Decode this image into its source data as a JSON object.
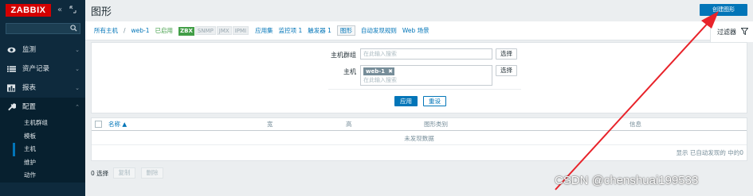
{
  "sidebar": {
    "logo": "ZABBIX",
    "collapse_glyph": "«",
    "expand_glyph": "⬚",
    "search_placeholder": "",
    "menu": [
      {
        "label": "监测",
        "icon": "eye-icon"
      },
      {
        "label": "资产记录",
        "icon": "list-icon"
      },
      {
        "label": "报表",
        "icon": "bar-chart-icon"
      },
      {
        "label": "配置",
        "icon": "wrench-icon"
      }
    ],
    "submenu": [
      "主机群组",
      "模板",
      "主机",
      "维护",
      "动作"
    ]
  },
  "header": {
    "title": "图形",
    "create_button": "创建图形"
  },
  "nav": {
    "all_hosts": "所有主机",
    "separator": "/",
    "host": "web-1",
    "status": "已启用",
    "tags": [
      "ZBX",
      "SNMP",
      "JMX",
      "IPMI"
    ],
    "links": [
      "应用集",
      "监控项 1",
      "触发器 1",
      "图形",
      "自动发现规则",
      "Web 场景"
    ]
  },
  "filter": {
    "tab_label": "过滤器",
    "host_group_label": "主机群组",
    "host_group_placeholder": "在此输入搜索",
    "host_label": "主机",
    "host_chip": "web-1",
    "host_placeholder": "在此输入搜索",
    "select_label": "选择",
    "apply_label": "应用",
    "reset_label": "重设"
  },
  "table": {
    "columns": [
      "名称 ▲",
      "宽",
      "高",
      "图形类别",
      "信息"
    ],
    "empty_text": "未发现数据",
    "footer": "显示 已自动发现的 中的0"
  },
  "actions": {
    "selected": "0 选择",
    "copy": "复制",
    "delete": "删除"
  },
  "watermark": "CSDN @chenshuai199533",
  "colors": {
    "brand_red": "#d40000",
    "sidebar": "#0e2a3d",
    "accent_blue": "#0275b8",
    "enabled_green": "#429e47",
    "arrow_red": "#e8232a"
  }
}
